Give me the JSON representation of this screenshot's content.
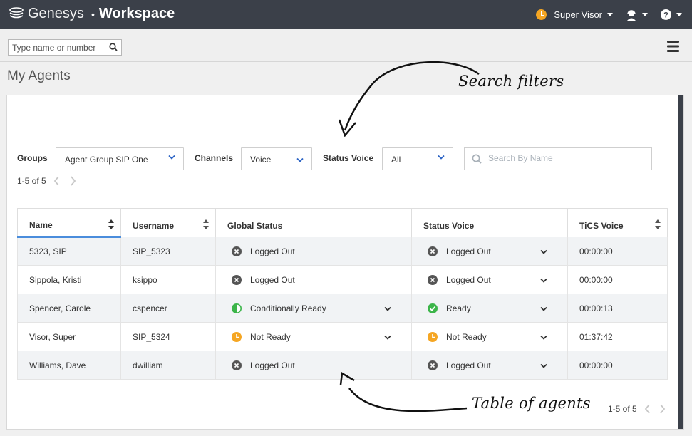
{
  "app": {
    "brand": "Genesys",
    "separator": "•",
    "product": "Workspace"
  },
  "header": {
    "user_name": "Super Visor",
    "user_status_color": "#f5a623"
  },
  "toolbar": {
    "search_placeholder": "Type name or number"
  },
  "page": {
    "title": "My Agents"
  },
  "filters": {
    "groups_label": "Groups",
    "groups_value": "Agent Group SIP One",
    "channels_label": "Channels",
    "channels_value": "Voice",
    "status_voice_label": "Status Voice",
    "status_voice_value": "All",
    "search_placeholder": "Search By Name"
  },
  "pagination": {
    "top_text": "1-5 of 5",
    "bottom_text": "1-5 of 5"
  },
  "table": {
    "headers": [
      "Name",
      "Username",
      "Global Status",
      "Status Voice",
      "TiCS Voice"
    ],
    "rows": [
      {
        "name": "5323, SIP",
        "username": "SIP_5323",
        "global_status": "Logged Out",
        "global_icon": "logged-out-icon",
        "voice_status": "Logged Out",
        "voice_icon": "logged-out-icon",
        "tics": "00:00:00"
      },
      {
        "name": "Sippola, Kristi",
        "username": "ksippo",
        "global_status": "Logged Out",
        "global_icon": "logged-out-icon",
        "voice_status": "Logged Out",
        "voice_icon": "logged-out-icon",
        "tics": "00:00:00"
      },
      {
        "name": "Spencer, Carole",
        "username": "cspencer",
        "global_status": "Conditionally Ready",
        "global_icon": "conditionally-ready-icon",
        "voice_status": "Ready",
        "voice_icon": "ready-icon",
        "tics": "00:00:13"
      },
      {
        "name": "Visor, Super",
        "username": "SIP_5324",
        "global_status": "Not Ready",
        "global_icon": "not-ready-icon",
        "voice_status": "Not Ready",
        "voice_icon": "not-ready-icon",
        "tics": "01:37:42"
      },
      {
        "name": "Williams, Dave",
        "username": "dwilliam",
        "global_status": "Logged Out",
        "global_icon": "logged-out-icon",
        "voice_status": "Logged Out",
        "voice_icon": "logged-out-icon",
        "tics": "00:00:00"
      }
    ]
  },
  "annotations": {
    "search_filters": "Search filters",
    "table_of_agents": "Table of agents"
  },
  "colors": {
    "header_bg": "#3b4049",
    "accent_blue": "#4a8ddc",
    "ready_green": "#3cb54a",
    "not_ready_orange": "#f5a623",
    "logged_out_gray": "#555555"
  }
}
